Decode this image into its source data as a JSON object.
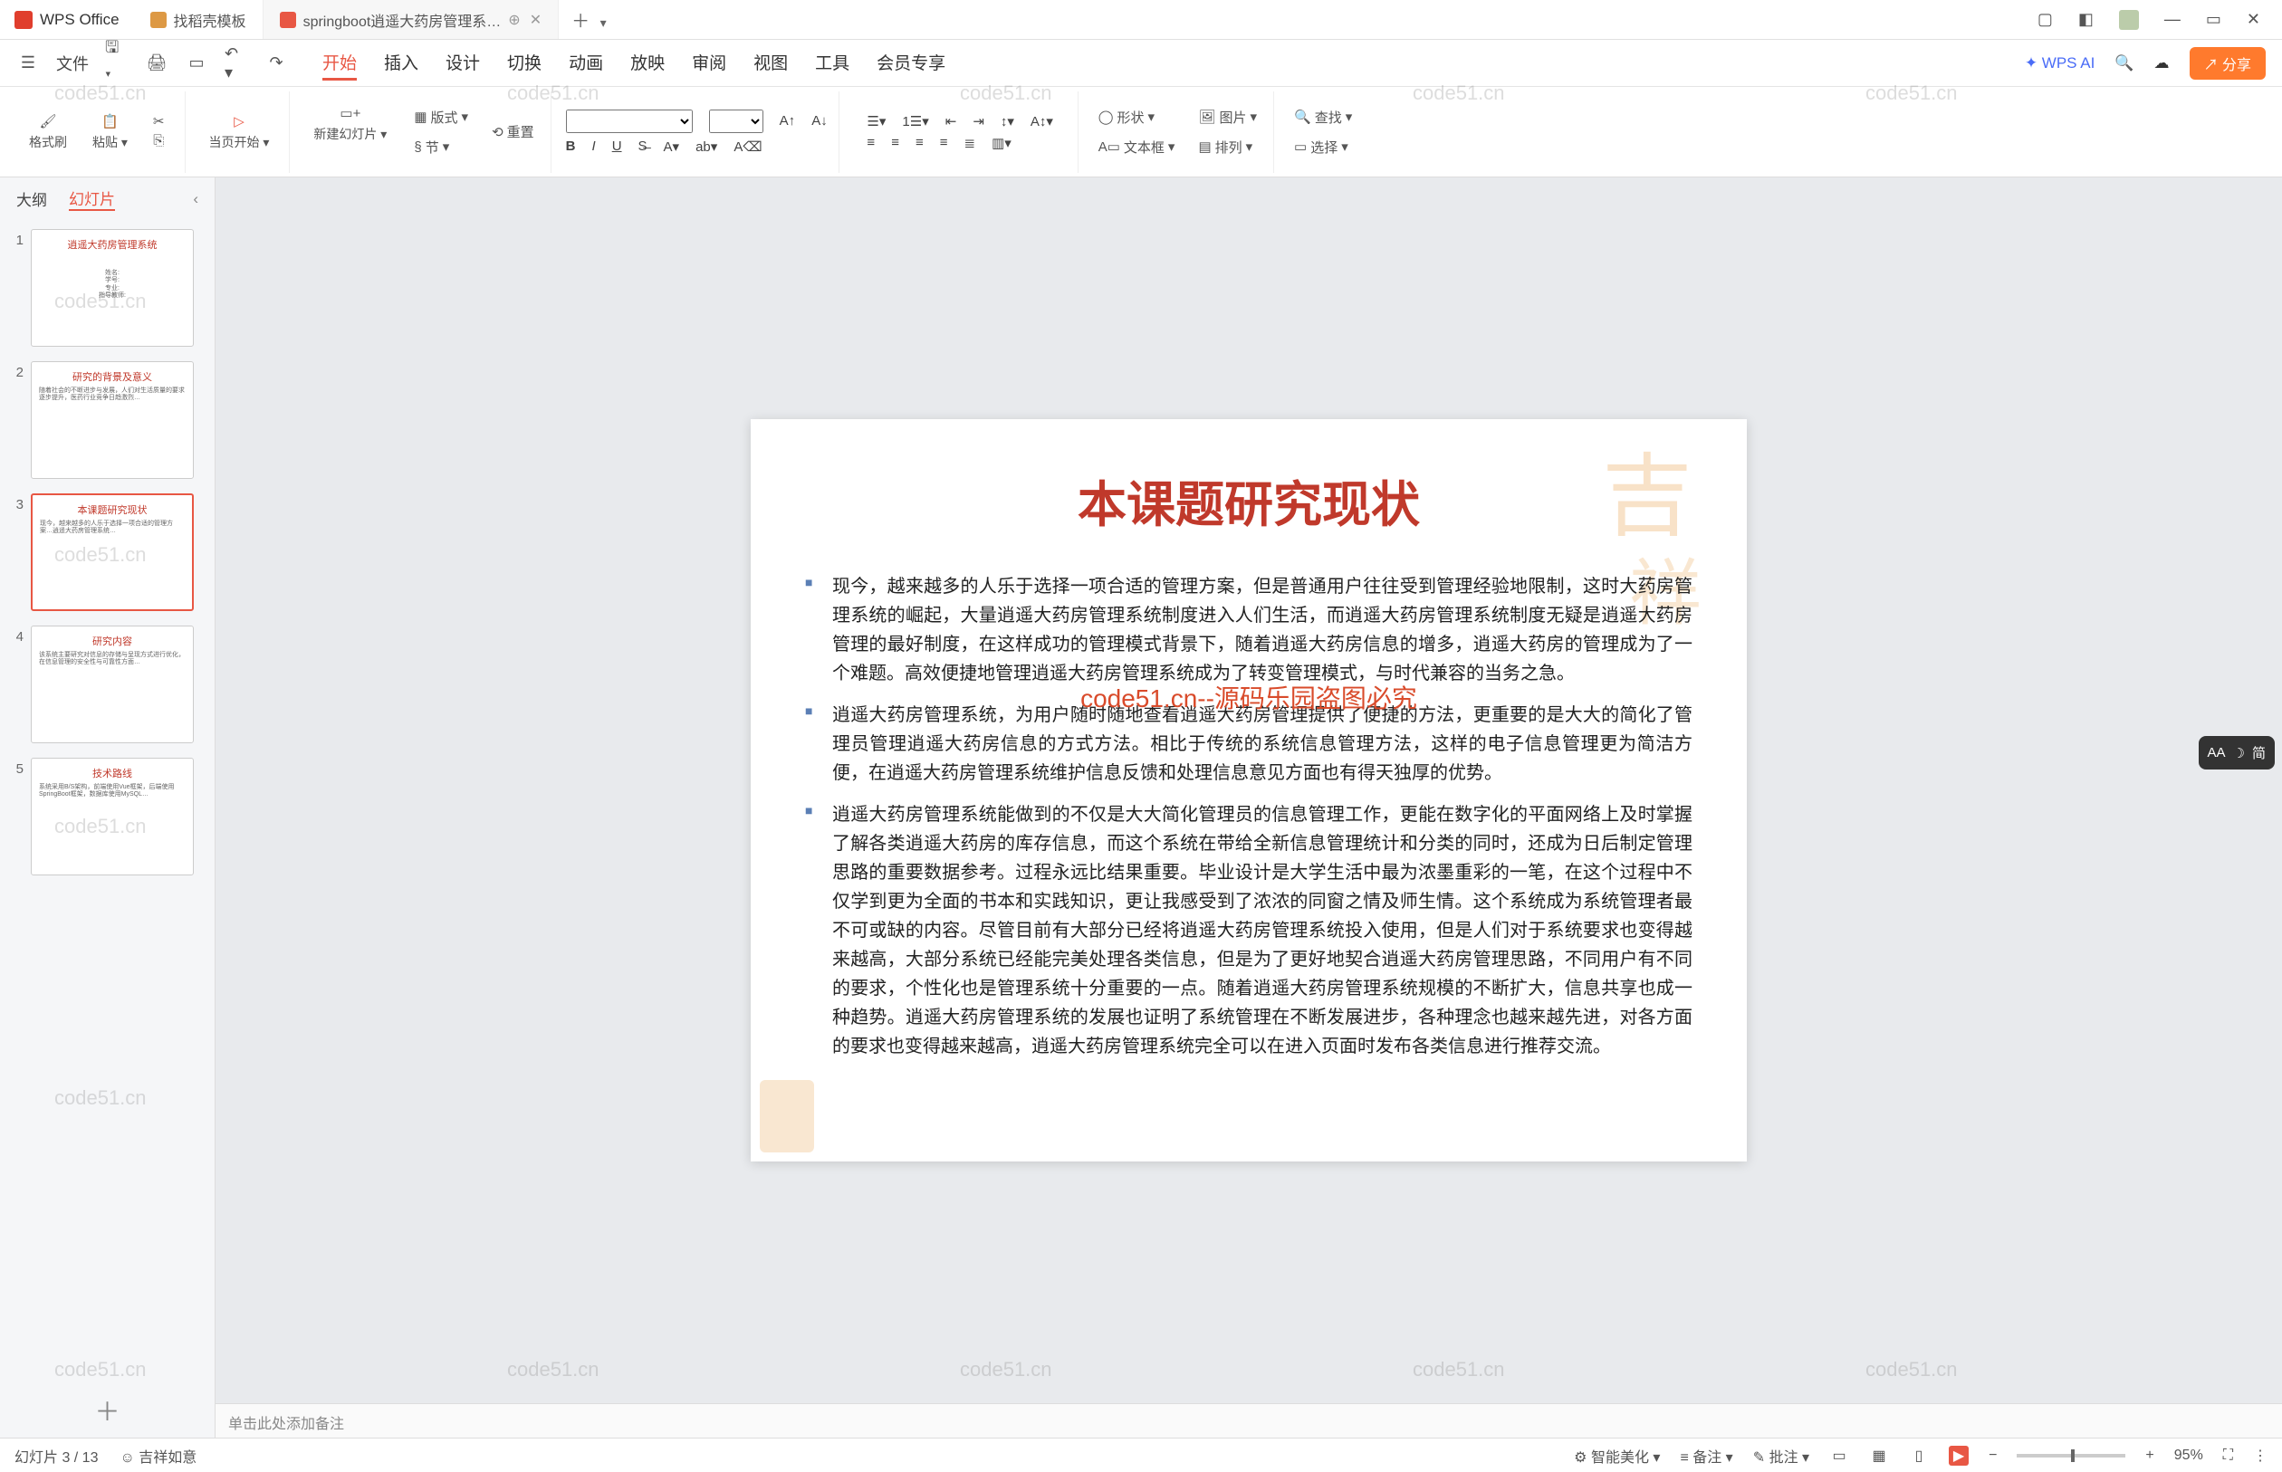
{
  "titlebar": {
    "brand": "WPS Office",
    "tabs": [
      {
        "label": "找稻壳模板",
        "active": false
      },
      {
        "label": "springboot逍遥大药房管理系…",
        "active": true
      }
    ],
    "plus": "＋",
    "dropdown": "▾"
  },
  "menubar": {
    "file": "文件",
    "tabs": [
      "开始",
      "插入",
      "设计",
      "切换",
      "动画",
      "放映",
      "审阅",
      "视图",
      "工具",
      "会员专享"
    ],
    "active_tab": "开始",
    "wps_ai": "WPS AI",
    "share": "分享"
  },
  "toolbar": {
    "format_painter": "格式刷",
    "paste": "粘贴",
    "from_current": "当页开始",
    "new_slide": "新建幻灯片",
    "layout": "版式",
    "section": "节",
    "reset": "重置",
    "shape": "形状",
    "picture": "图片",
    "textbox": "文本框",
    "arrange": "排列",
    "find": "查找",
    "select": "选择"
  },
  "sidebar": {
    "tab_outline": "大纲",
    "tab_slides": "幻灯片",
    "collapse": "‹",
    "thumbs": [
      {
        "num": "1",
        "title": "逍遥大药房管理系统",
        "body": "姓名:\n学号:\n专业:\n指导教师:"
      },
      {
        "num": "2",
        "title": "研究的背景及意义",
        "body": "随着社会的不断进步与发展，人们对生活质量的要求逐步提升，医药行业竞争日趋激烈…"
      },
      {
        "num": "3",
        "title": "本课题研究现状",
        "body": "现今，越来越多的人乐于选择一项合适的管理方案…逍遥大药房管理系统…"
      },
      {
        "num": "4",
        "title": "研究内容",
        "body": "该系统主要研究对信息的存储与呈现方式进行优化，在信息管理的安全性与可靠性方面…"
      },
      {
        "num": "5",
        "title": "技术路线",
        "body": "系统采用B/S架构，前端使用Vue框架，后端使用SpringBoot框架，数据库使用MySQL…"
      }
    ],
    "add": "＋"
  },
  "slide": {
    "title": "本课题研究现状",
    "bullets": [
      "现今，越来越多的人乐于选择一项合适的管理方案，但是普通用户往往受到管理经验地限制，这时大药房管理系统的崛起，大量逍遥大药房管理系统制度进入人们生活，而逍遥大药房管理系统制度无疑是逍遥大药房管理的最好制度，在这样成功的管理模式背景下，随着逍遥大药房信息的增多，逍遥大药房的管理成为了一个难题。高效便捷地管理逍遥大药房管理系统成为了转变管理模式，与时代兼容的当务之急。",
      "逍遥大药房管理系统，为用户随时随地查看逍遥大药房管理提供了便捷的方法，更重要的是大大的简化了管理员管理逍遥大药房信息的方式方法。相比于传统的系统信息管理方法，这样的电子信息管理更为简洁方便，在逍遥大药房管理系统维护信息反馈和处理信息意见方面也有得天独厚的优势。",
      "逍遥大药房管理系统能做到的不仅是大大简化管理员的信息管理工作，更能在数字化的平面网络上及时掌握了解各类逍遥大药房的库存信息，而这个系统在带给全新信息管理统计和分类的同时，还成为日后制定管理思路的重要数据参考。过程永远比结果重要。毕业设计是大学生活中最为浓墨重彩的一笔，在这个过程中不仅学到更为全面的书本和实践知识，更让我感受到了浓浓的同窗之情及师生情。这个系统成为系统管理者最不可或缺的内容。尽管目前有大部分已经将逍遥大药房管理系统投入使用，但是人们对于系统要求也变得越来越高，大部分系统已经能完美处理各类信息，但是为了更好地契合逍遥大药房管理思路，不同用户有不同的要求，个性化也是管理系统十分重要的一点。随着逍遥大药房管理系统规模的不断扩大，信息共享也成一种趋势。逍遥大药房管理系统的发展也证明了系统管理在不断发展进步，各种理念也越来越先进，对各方面的要求也变得越来越高，逍遥大药房管理系统完全可以在进入页面时发布各类信息进行推荐交流。"
    ],
    "watermark_center": "code51.cn--源码乐园盗图必究"
  },
  "notes": {
    "placeholder": "单击此处添加备注"
  },
  "statusbar": {
    "slide_count": "幻灯片 3 / 13",
    "theme": "吉祥如意",
    "smart_beautify": "智能美化",
    "notes_btn": "备注",
    "comments_btn": "批注",
    "zoom": "95%"
  },
  "right_rail": {
    "label": "AA",
    "mode": "简"
  },
  "watermark": "code51.cn"
}
